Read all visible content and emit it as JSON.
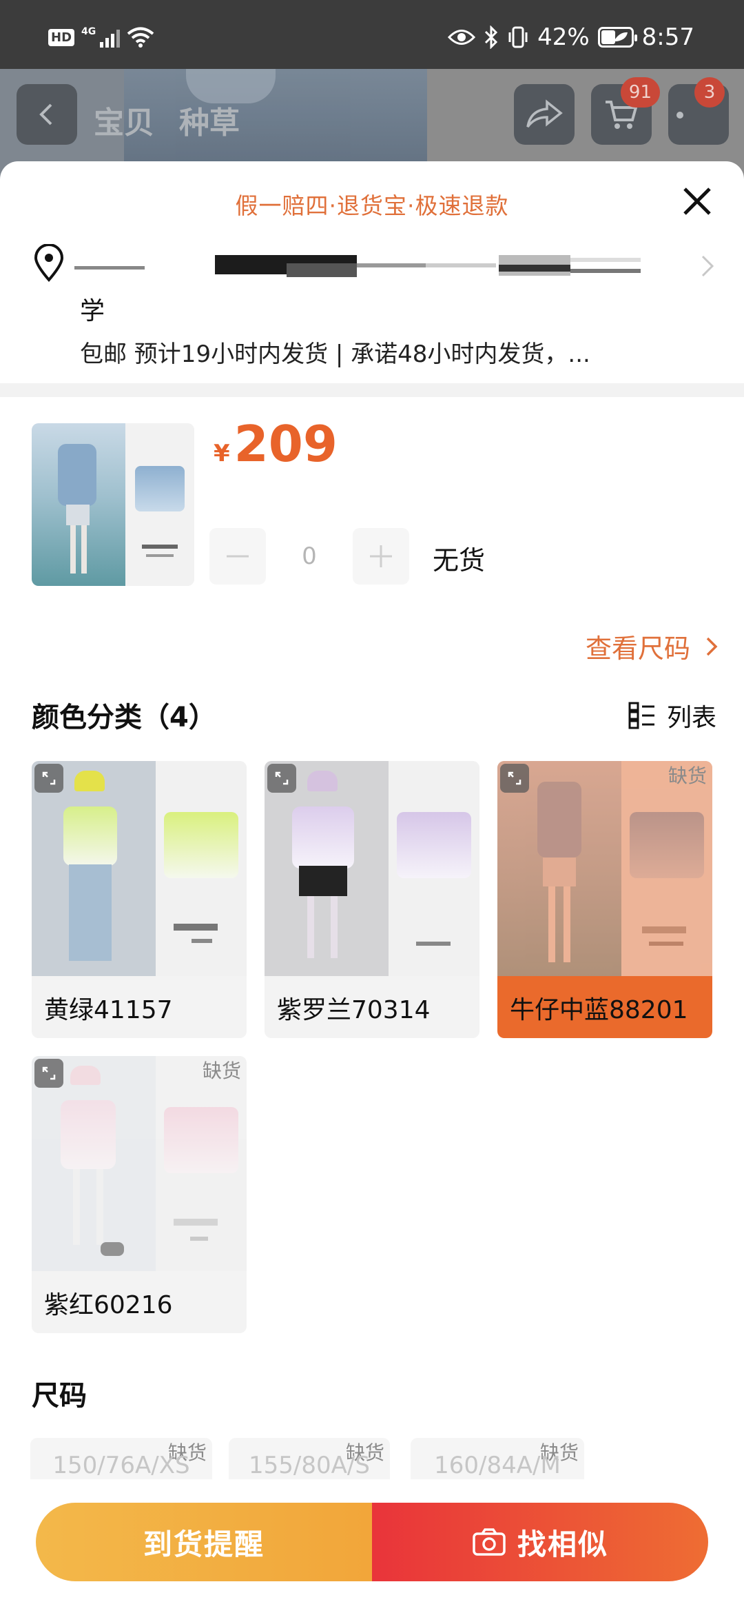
{
  "status_bar": {
    "hd": "HD",
    "network": "4G",
    "battery": "42%",
    "time": "8:57"
  },
  "nav": {
    "tabs": [
      "宝贝",
      "种草"
    ],
    "cart_badge": "91",
    "more_badge": "3"
  },
  "sheet": {
    "guarantee": "假一赔四·退货宝·极速退款",
    "address_line2": "学",
    "shipping": "包邮  预计19小时内发货 | 承诺48小时内发货，...",
    "price_symbol": "¥",
    "price": "209",
    "quantity": "0",
    "stock_status": "无货",
    "size_chart_link": "查看尺码",
    "color_section_title": "颜色分类（4）",
    "view_toggle_label": "列表",
    "colors": [
      {
        "name": "黄绿41157",
        "swatch_label": "黄绿",
        "sold_out": false,
        "selected": false,
        "tint": "#d7ef8a"
      },
      {
        "name": "紫罗兰70314",
        "swatch_label": "紫罗兰",
        "sold_out": false,
        "selected": false,
        "tint": "#d9cbe8"
      },
      {
        "name": "牛仔中蓝88201",
        "swatch_label": "牛仔中蓝",
        "sold_out": true,
        "selected": true,
        "tint": "#a9c3dc"
      },
      {
        "name": "紫红60216",
        "swatch_label": "紫红",
        "sold_out": true,
        "selected": false,
        "tint": "#efc6d3"
      }
    ],
    "sold_out_tag": "缺货",
    "size_section_title": "尺码",
    "sizes": [
      {
        "label": "150/76A/XS",
        "tag": "缺货"
      },
      {
        "label": "155/80A/S",
        "tag": "缺货"
      },
      {
        "label": "160/84A/M",
        "tag": "缺货"
      }
    ],
    "notify_button": "到货提醒",
    "similar_button": "找相似"
  },
  "colors": {
    "accent": "#e8632a",
    "notify_gradient_start": "#f3b84a",
    "similar_gradient_start": "#e9343a"
  }
}
